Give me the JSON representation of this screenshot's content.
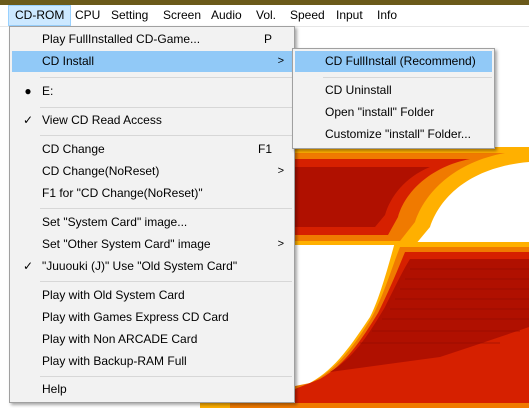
{
  "menubar": {
    "items": [
      "CD-ROM",
      "CPU",
      "Setting",
      "Screen",
      "Audio",
      "Vol.",
      "Speed",
      "Input",
      "Info"
    ]
  },
  "cdrom_menu": {
    "play_fullinstalled": {
      "label": "Play FullInstalled CD-Game...",
      "shortcut": "P"
    },
    "cd_install": {
      "label": "CD Install",
      "arrow": ">"
    },
    "drive_e": {
      "label": "E:",
      "mark": "●"
    },
    "view_cd_read_access": {
      "label": "View CD Read Access",
      "mark": "✓"
    },
    "cd_change": {
      "label": "CD Change",
      "shortcut": "F1"
    },
    "cd_change_noreset": {
      "label": "CD Change(NoReset)",
      "arrow": ">"
    },
    "f1_for": {
      "label": "F1 for \"CD Change(NoReset)\""
    },
    "set_system_card": {
      "label": "Set \"System Card\" image..."
    },
    "set_other_system_card": {
      "label": "Set \"Other System Card\" image",
      "arrow": ">"
    },
    "juuouki": {
      "label": "\"Juuouki (J)\" Use \"Old System Card\"",
      "mark": "✓"
    },
    "play_old_system_card": {
      "label": "Play with Old System Card"
    },
    "play_games_express": {
      "label": "Play with Games Express CD Card"
    },
    "play_non_arcade": {
      "label": "Play with Non ARCADE Card"
    },
    "play_backup_ram_full": {
      "label": "Play with Backup-RAM Full"
    },
    "help": {
      "label": "Help"
    }
  },
  "cd_install_submenu": {
    "full_install": {
      "label": "CD FullInstall (Recommend)"
    },
    "uninstall": {
      "label": "CD Uninstall"
    },
    "open_install_folder": {
      "label": "Open \"install\" Folder"
    },
    "customize_install_folder": {
      "label": "Customize \"install\" Folder..."
    }
  },
  "colors": {
    "highlight": "#91c9f7",
    "menu_bg": "#f2f2f2",
    "game_dark_red": "#b01000",
    "game_red": "#d62000",
    "game_orange": "#f07a00",
    "game_yellow": "#ffb000"
  }
}
